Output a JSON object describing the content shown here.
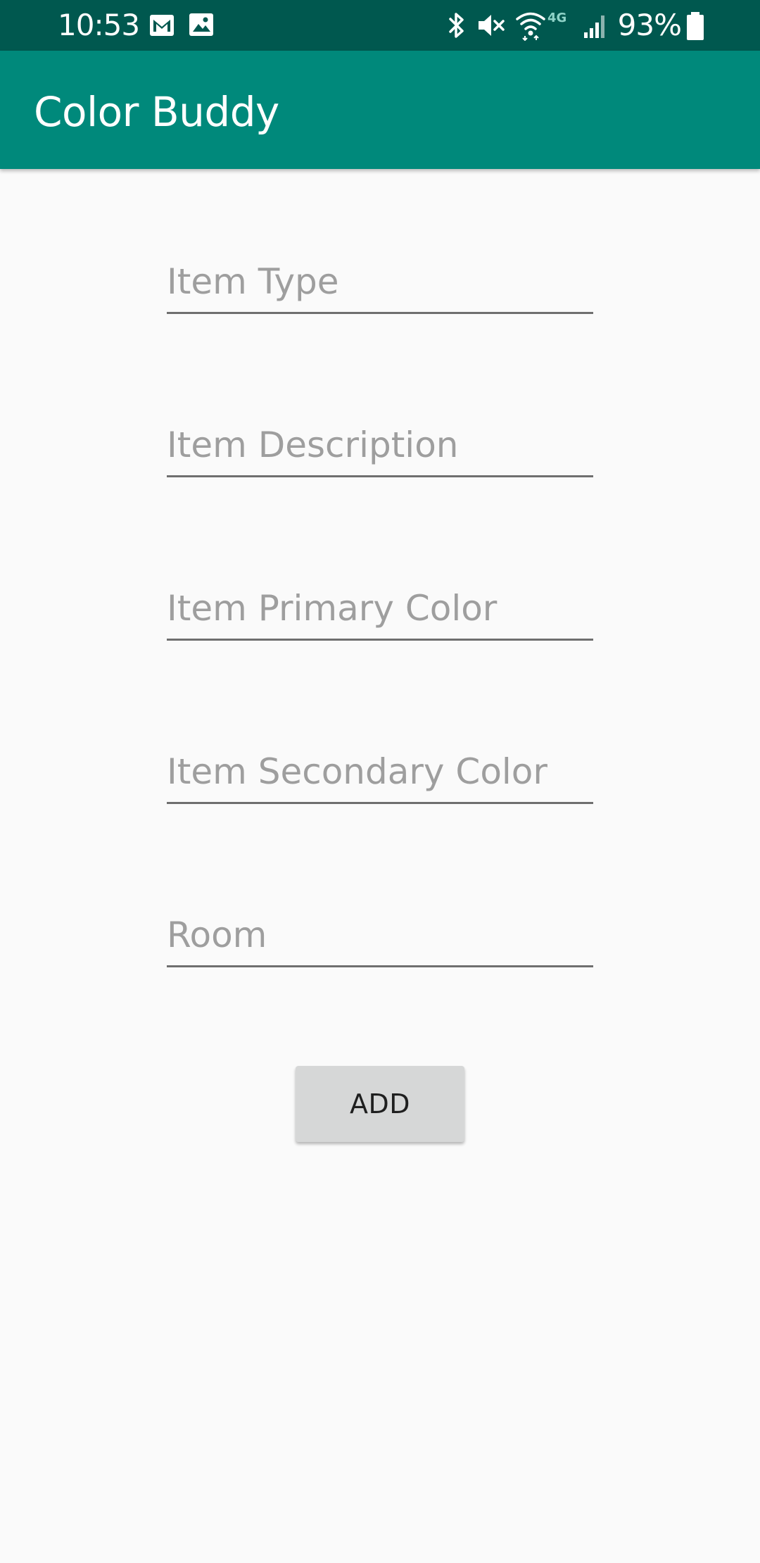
{
  "status_bar": {
    "time": "10:53",
    "battery_percent": "93%",
    "network_label": "4G",
    "icons": [
      "gmail-icon",
      "image-icon",
      "bluetooth-icon",
      "mute-icon",
      "wifi-icon",
      "lte-icon",
      "signal-icon",
      "battery-icon"
    ],
    "background_color": "#00584f"
  },
  "app_bar": {
    "title": "Color Buddy",
    "background_color": "#00897b"
  },
  "form": {
    "fields": [
      {
        "placeholder": "Item Type",
        "value": ""
      },
      {
        "placeholder": "Item Description",
        "value": ""
      },
      {
        "placeholder": "Item Primary Color",
        "value": ""
      },
      {
        "placeholder": "Item Secondary Color",
        "value": ""
      },
      {
        "placeholder": "Room",
        "value": ""
      }
    ],
    "add_label": "ADD"
  }
}
